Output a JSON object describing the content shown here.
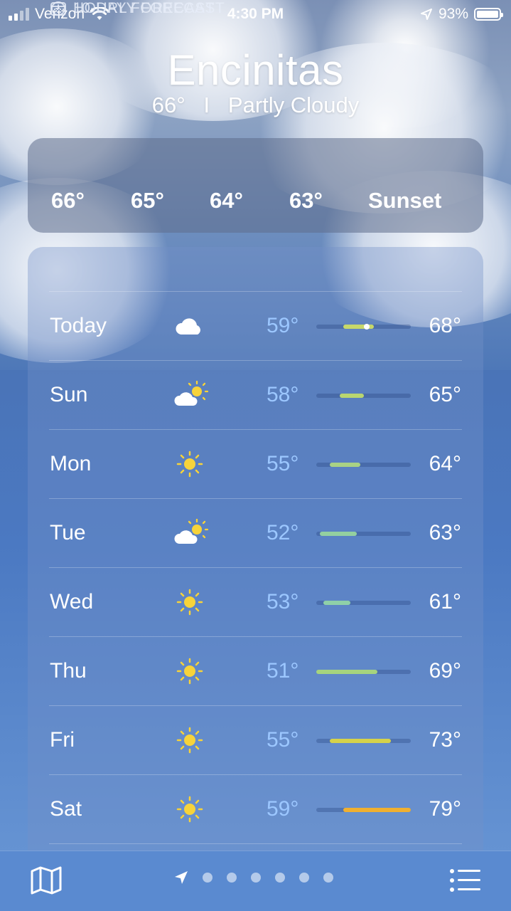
{
  "status_bar": {
    "carrier": "Verizon",
    "time": "4:30 PM",
    "battery": "93%"
  },
  "header": {
    "city": "Encinitas",
    "current_temp": "66°",
    "separator": "I",
    "condition": "Partly Cloudy"
  },
  "hourly": {
    "title": "HOURLY FORECAST",
    "items": [
      "66°",
      "65°",
      "64°",
      "63°",
      "Sunset"
    ]
  },
  "ten_day": {
    "title": "10-DAY FORECAST",
    "range_min": 51,
    "range_max": 79,
    "days": [
      {
        "day": "Today",
        "icon": "cloud-icon",
        "lo": "59°",
        "hi": "68°",
        "lo_val": 59,
        "hi_val": 68,
        "current": 66,
        "color": "#c7d86a"
      },
      {
        "day": "Sun",
        "icon": "partly-sunny-icon",
        "lo": "58°",
        "hi": "65°",
        "lo_val": 58,
        "hi_val": 65,
        "color": "#b9d670"
      },
      {
        "day": "Mon",
        "icon": "sun-icon",
        "lo": "55°",
        "hi": "64°",
        "lo_val": 55,
        "hi_val": 64,
        "color": "#a9d284"
      },
      {
        "day": "Tue",
        "icon": "partly-sunny-icon",
        "lo": "52°",
        "hi": "63°",
        "lo_val": 52,
        "hi_val": 63,
        "color": "#93d0a0"
      },
      {
        "day": "Wed",
        "icon": "sun-icon",
        "lo": "53°",
        "hi": "61°",
        "lo_val": 53,
        "hi_val": 61,
        "color": "#8fd0a8"
      },
      {
        "day": "Thu",
        "icon": "sun-icon",
        "lo": "51°",
        "hi": "69°",
        "lo_val": 51,
        "hi_val": 69,
        "color": "#a6d47e"
      },
      {
        "day": "Fri",
        "icon": "sun-icon",
        "lo": "55°",
        "hi": "73°",
        "lo_val": 55,
        "hi_val": 73,
        "color": "#d6d24a"
      },
      {
        "day": "Sat",
        "icon": "sun-icon",
        "lo": "59°",
        "hi": "79°",
        "lo_val": 59,
        "hi_val": 79,
        "color": "#f0b030"
      }
    ]
  },
  "bottom_bar": {
    "map_icon": "map-icon",
    "location_icon": "location-arrow-icon",
    "page_count": 6,
    "list_icon": "list-icon"
  }
}
